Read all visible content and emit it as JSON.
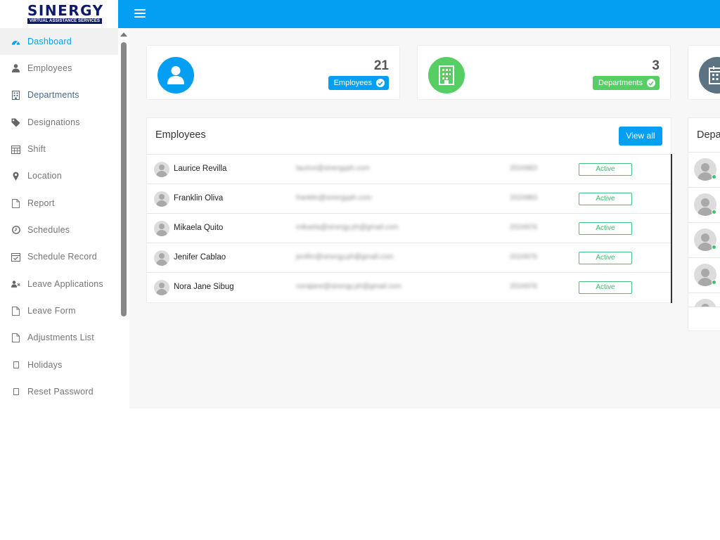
{
  "header": {
    "logo_title": "SINERGY",
    "logo_subtitle": "VIRTUAL ASSISTANCE SERVICES",
    "accent_color": "#049ff3",
    "menu_icon": "hamburger-icon"
  },
  "sidebar": {
    "items": [
      {
        "label": "Dashboard",
        "icon": "dashboard-icon",
        "active": true
      },
      {
        "label": "Employees",
        "icon": "user-icon"
      },
      {
        "label": "Departments",
        "icon": "building-icon"
      },
      {
        "label": "Designations",
        "icon": "tag-icon"
      },
      {
        "label": "Shift",
        "icon": "calendar-icon"
      },
      {
        "label": "Location",
        "icon": "map-pin-icon"
      },
      {
        "label": "Report",
        "icon": "file-icon"
      },
      {
        "label": "Schedules",
        "icon": "clock-icon"
      },
      {
        "label": "Schedule Record",
        "icon": "calendar-check-icon"
      },
      {
        "label": "Leave Applications",
        "icon": "user-x-icon"
      },
      {
        "label": "Leave Form",
        "icon": "file-icon"
      },
      {
        "label": "Adjustments List",
        "icon": "file-icon"
      },
      {
        "label": "Holidays",
        "icon": "square-icon"
      },
      {
        "label": "Reset Password",
        "icon": "square-icon"
      }
    ]
  },
  "stats": {
    "employees": {
      "count": "21",
      "label": "Employees",
      "color": "#049ff3"
    },
    "departments": {
      "count": "3",
      "label": "Departments",
      "color": "#55ce63"
    }
  },
  "employees_panel": {
    "title": "Employees",
    "view_all": "View all",
    "rows": [
      {
        "name": "Laurice Revilla",
        "email": "laurice@sinergyph.com",
        "phone": "2024983",
        "status": "Active"
      },
      {
        "name": "Franklin Oliva",
        "email": "franklin@sinergyph.com",
        "phone": "2024983",
        "status": "Active"
      },
      {
        "name": "Mikaela Quito",
        "email": "mikaela@sinergy.ph@gmail.com",
        "phone": "2024976",
        "status": "Active"
      },
      {
        "name": "Jenifer Cablao",
        "email": "jenifer@sinergy.ph@gmail.com",
        "phone": "2024976",
        "status": "Active"
      },
      {
        "name": "Nora Jane Sibug",
        "email": "norajane@sinergy.ph@gmail.com",
        "phone": "2024976",
        "status": "Active"
      }
    ]
  },
  "departments_panel": {
    "title": "Depa"
  },
  "colors": {
    "status_green": "#3bb86e",
    "online_dot": "#3cc56e",
    "calendar_card": "#5b7383"
  }
}
